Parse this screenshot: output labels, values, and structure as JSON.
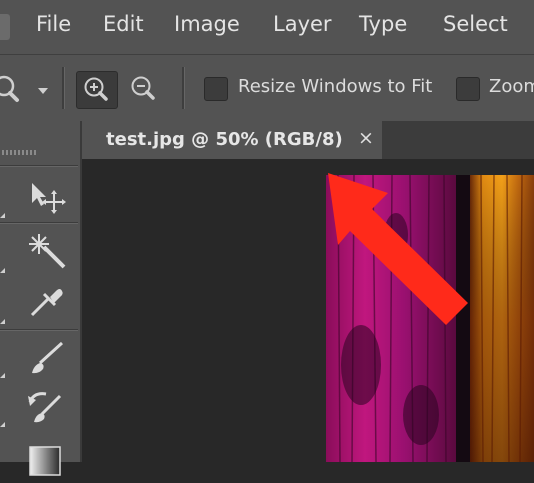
{
  "menu": {
    "items": [
      "File",
      "Edit",
      "Image",
      "Layer",
      "Type",
      "Select"
    ]
  },
  "options_bar": {
    "resize_windows_label": "Resize Windows to Fit",
    "zoom_label": "Zoom"
  },
  "document": {
    "tab_title": "test.jpg @ 50% (RGB/8)",
    "close_glyph": "×"
  },
  "colors": {
    "arrow": "#ff2a1a",
    "ui_panel": "#535353",
    "canvas_bg": "#282828"
  },
  "icons": [
    "zoom-tool-icon",
    "zoom-in-icon",
    "zoom-out-icon",
    "move-tool-icon",
    "magic-wand-icon",
    "eyedropper-icon",
    "brush-icon",
    "history-brush-icon",
    "gradient-icon",
    "annotation-arrow-icon"
  ]
}
